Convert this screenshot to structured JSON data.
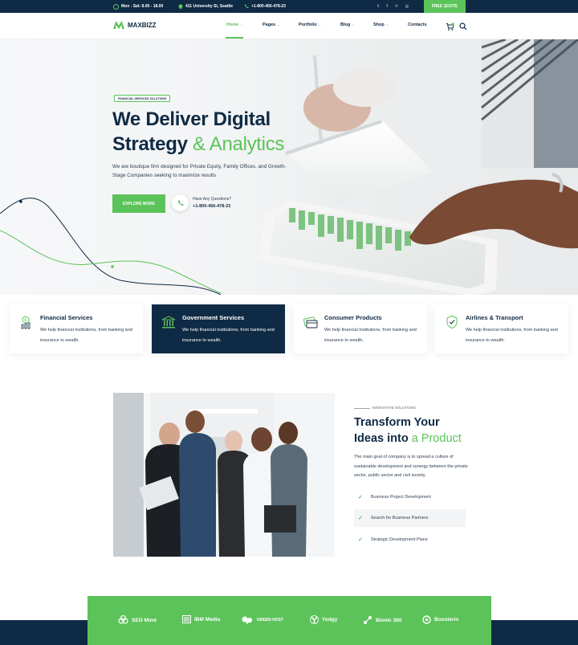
{
  "topbar": {
    "hours": "Mon - Sat: 8.00 - 18.00",
    "address": "411 University St, Seattle",
    "phone": "+1-800-456-478-23",
    "social": [
      "twitter",
      "facebook",
      "pinterest",
      "instagram"
    ],
    "quote_label": "FREE QUOTE"
  },
  "nav": {
    "logo": "MAXBIZZ",
    "items": [
      {
        "label": "Home",
        "active": true
      },
      {
        "label": "Pages"
      },
      {
        "label": "Portfolio"
      },
      {
        "label": "Blog"
      },
      {
        "label": "Shop"
      },
      {
        "label": "Contacts"
      }
    ]
  },
  "hero": {
    "tag": "FINANCIAL SERVICES SOLUTIONS",
    "title_line1": "We Deliver Digital",
    "title_line2_main": "Strategy ",
    "title_line2_green": "& Analytics",
    "description": "We are boutique firm designed for Private Equity, Family Offices, and Growth-Stage Companies seeking to maximize results",
    "cta_label": "EXPLORE MORE",
    "question": "Have Any Questions?",
    "phone": "+1-800-456-478-23"
  },
  "services": [
    {
      "title": "Financial Services",
      "text": "We help financial institutions, from banking and insurance to wealth.",
      "icon": "money-bag-icon"
    },
    {
      "title": "Government Services",
      "text": "We help financial institutions, from banking and insurance to wealth.",
      "icon": "bank-icon"
    },
    {
      "title": "Consumer Products",
      "text": "We help financial institutions, from banking and insurance to wealth.",
      "icon": "credit-card-icon"
    },
    {
      "title": "Airlines & Transport",
      "text": "We help financial institutions, from banking and insurance to wealth.",
      "icon": "shield-icon"
    }
  ],
  "about": {
    "tag": "INNOVATIVE SOLUTIONS",
    "title_line1": "Transform Your",
    "title_line2_main": "Ideas into ",
    "title_line2_green": "a Product",
    "description": "The main goal of company is to spread a culture of sustainable development and synergy between the private sector, public sector and civil society.",
    "checklist": [
      "Business Project Development",
      "Search for Business Partners",
      "Strategic Development Plans"
    ]
  },
  "partners": [
    "SEO Mind",
    "IBM Media",
    "GREEN HOST",
    "Yodgy",
    "Bionic 360",
    "Boosterio"
  ],
  "colors": {
    "navy": "#0f2a44",
    "green": "#5cc35a"
  }
}
